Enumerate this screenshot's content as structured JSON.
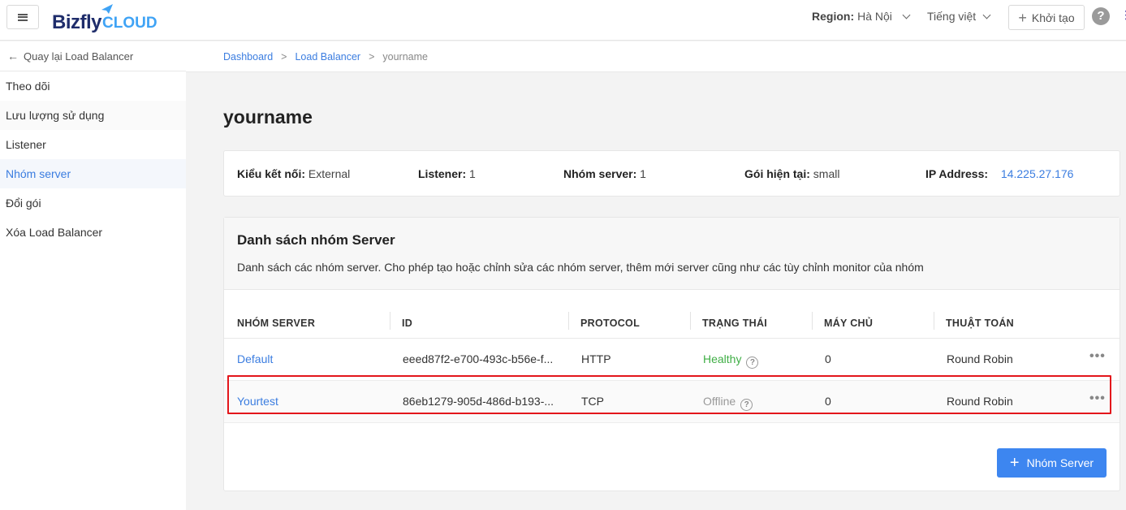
{
  "topbar": {
    "brand_main": "Bizfly",
    "brand_cloud": "CLOUD",
    "region_label": "Region:",
    "region_value": "Hà Nội",
    "language": "Tiếng việt",
    "create_label": "Khởi tạo",
    "help_symbol": "?"
  },
  "sidebar": {
    "back_label": "Quay lại Load Balancer",
    "items": [
      {
        "label": "Theo dõi"
      },
      {
        "label": "Lưu lượng sử dụng"
      },
      {
        "label": "Listener"
      },
      {
        "label": "Nhóm server"
      },
      {
        "label": "Đổi gói"
      },
      {
        "label": "Xóa Load Balancer"
      }
    ],
    "active_index": 3
  },
  "breadcrumb": {
    "items": [
      "Dashboard",
      "Load Balancer"
    ],
    "current": "yourname"
  },
  "page": {
    "title": "yourname"
  },
  "info": {
    "connection_label": "Kiểu kết nối:",
    "connection_value": "External",
    "listener_label": "Listener:",
    "listener_value": "1",
    "server_group_label": "Nhóm server:",
    "server_group_value": "1",
    "plan_label": "Gói hiện tại:",
    "plan_value": "small",
    "ip_label": "IP Address:",
    "ip_value": "14.225.27.176"
  },
  "server_list": {
    "title": "Danh sách nhóm Server",
    "description": "Danh sách các nhóm server. Cho phép tạo hoặc chỉnh sửa các nhóm server, thêm mới server cũng như các tùy chỉnh monitor của nhóm",
    "columns": [
      "NHÓM SERVER",
      "ID",
      "PROTOCOL",
      "TRẠNG THÁI",
      "MÁY CHỦ",
      "THUẬT TOÁN"
    ],
    "rows": [
      {
        "name": "Default",
        "id": "eeed87f2-e700-493c-b56e-f...",
        "protocol": "HTTP",
        "status": "Healthy",
        "servers": "0",
        "algorithm": "Round Robin"
      },
      {
        "name": "Yourtest",
        "id": "86eb1279-905d-486d-b193-...",
        "protocol": "TCP",
        "status": "Offline",
        "servers": "0",
        "algorithm": "Round Robin"
      }
    ],
    "add_button_label": "Nhóm Server"
  },
  "colors": {
    "accent": "#3d86f0",
    "healthy": "#3fae45",
    "highlight": "#e3161b"
  }
}
